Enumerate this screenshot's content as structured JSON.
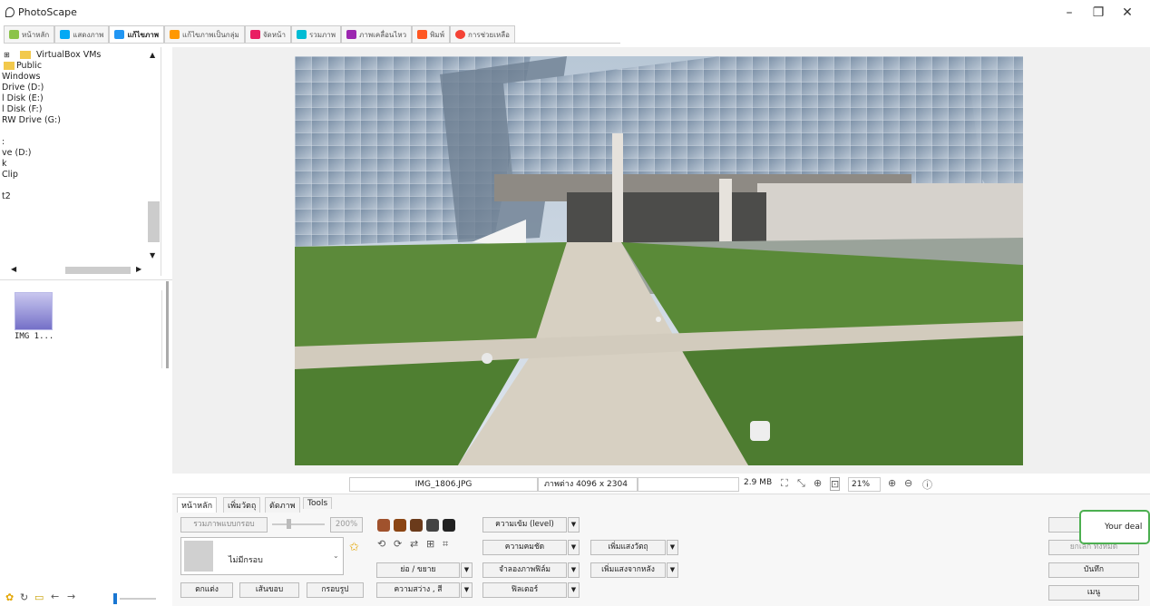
{
  "app": {
    "title": "PhotoScape"
  },
  "window_controls": {
    "minimize": "–",
    "restore": "❐",
    "close": "✕"
  },
  "tabs": [
    {
      "label": "หน้าหลัก",
      "color": "#8bc34a"
    },
    {
      "label": "แสดงภาพ",
      "color": "#03a9f4"
    },
    {
      "label": "แก้ไขภาพ",
      "color": "#2196f3"
    },
    {
      "label": "แก้ไขภาพเป็นกลุ่ม",
      "color": "#ff9800"
    },
    {
      "label": "จัดหน้า",
      "color": "#e91e63"
    },
    {
      "label": "รวมภาพ",
      "color": "#00bcd4"
    },
    {
      "label": "ภาพเคลื่อนไหว",
      "color": "#9c27b0"
    },
    {
      "label": "พิมพ์",
      "color": "#ff5722"
    },
    {
      "label": "การช่วยเหลือ",
      "color": "#f44336"
    }
  ],
  "tree": [
    "VirtualBox VMs",
    "Public",
    "Windows",
    "Drive (D:)",
    "l Disk (E:)",
    "l Disk (F:)",
    "RW Drive (G:)",
    ":",
    "ve (D:)",
    "k",
    "Clip",
    "",
    "t2"
  ],
  "thumb": {
    "label": "IMG 1..."
  },
  "status": {
    "filename": "IMG_1806.JPG",
    "dimensions": "ภาพต่าง 4096 x 2304",
    "filesize": "2.9 MB",
    "zoom": "21%"
  },
  "editor_tabs": [
    "หน้าหลัก",
    "เพิ่มวัตถุ",
    "ตัดภาพ",
    "Tools"
  ],
  "editor": {
    "resize_btn": "รวมภาพแบบกรอบ",
    "zoom_value": "200%",
    "frame_select": "ไม่มีกรอบ",
    "bottom_btns": [
      "ตกแต่ง",
      "เส้นขอบ",
      "กรอบรูป"
    ],
    "size_btn": "ย่อ / ขยาย",
    "brightness_btn": "ความสว่าง , สี",
    "level_btn": "ความเข้ม (level)",
    "sharpen_btn": "ความคมชัด",
    "film_btn": "จำลองภาพฟิล์ม",
    "filter_btn": "ฟิลเตอร์",
    "effect1": "เพิ่มแสงวัตถุ",
    "effect2": "เพิ่มแสงจากหลัง",
    "right_btns": [
      "ยกเลิก",
      "ยกเลิก ทั้งหมด",
      "บันทึก",
      "เมนู"
    ]
  },
  "toast": {
    "text": "Your deal"
  },
  "accent": "#4caf50"
}
